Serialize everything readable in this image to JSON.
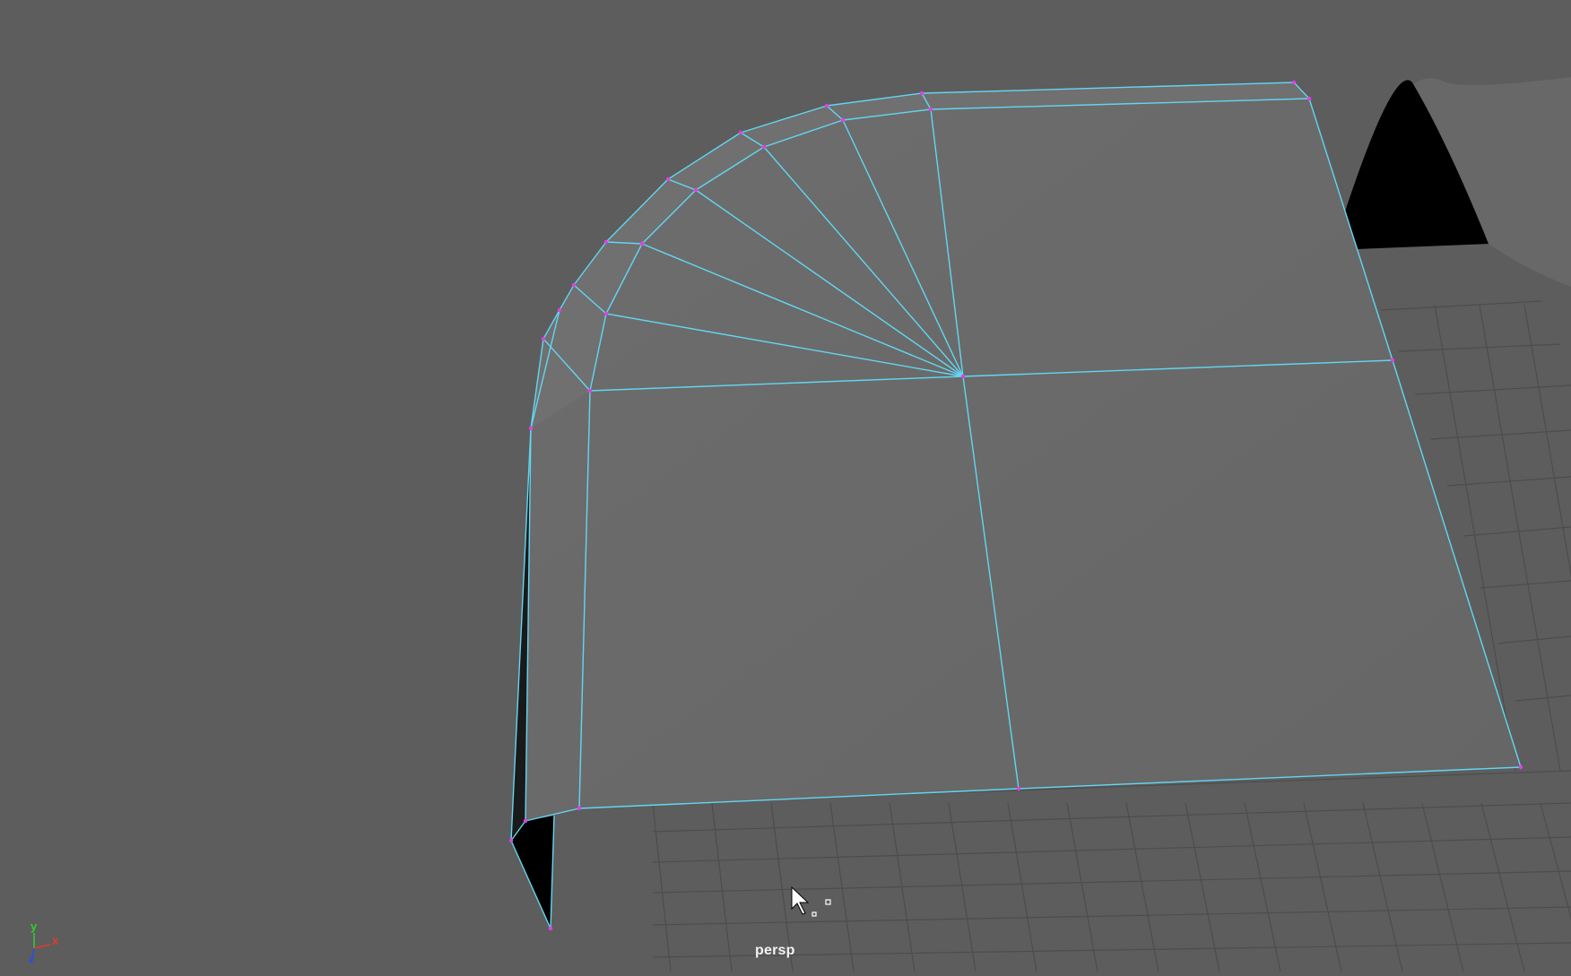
{
  "viewport": {
    "camera_label": "persp"
  },
  "axis_gizmo": {
    "x_label": "x",
    "y_label": "y",
    "z_label": "z",
    "x_color": "#e23a2c",
    "y_color": "#2fd12f",
    "z_color": "#2a4be8"
  },
  "colors": {
    "background": "#5d5d5d",
    "grid": "#4c4c4c",
    "mesh_fill": "#6a6a6a",
    "wireframe": "#62d6f2",
    "vertex": "#e040e8",
    "shadow_face": "#000000"
  },
  "icons": {
    "cursor": "arrow-pointer-icon"
  }
}
